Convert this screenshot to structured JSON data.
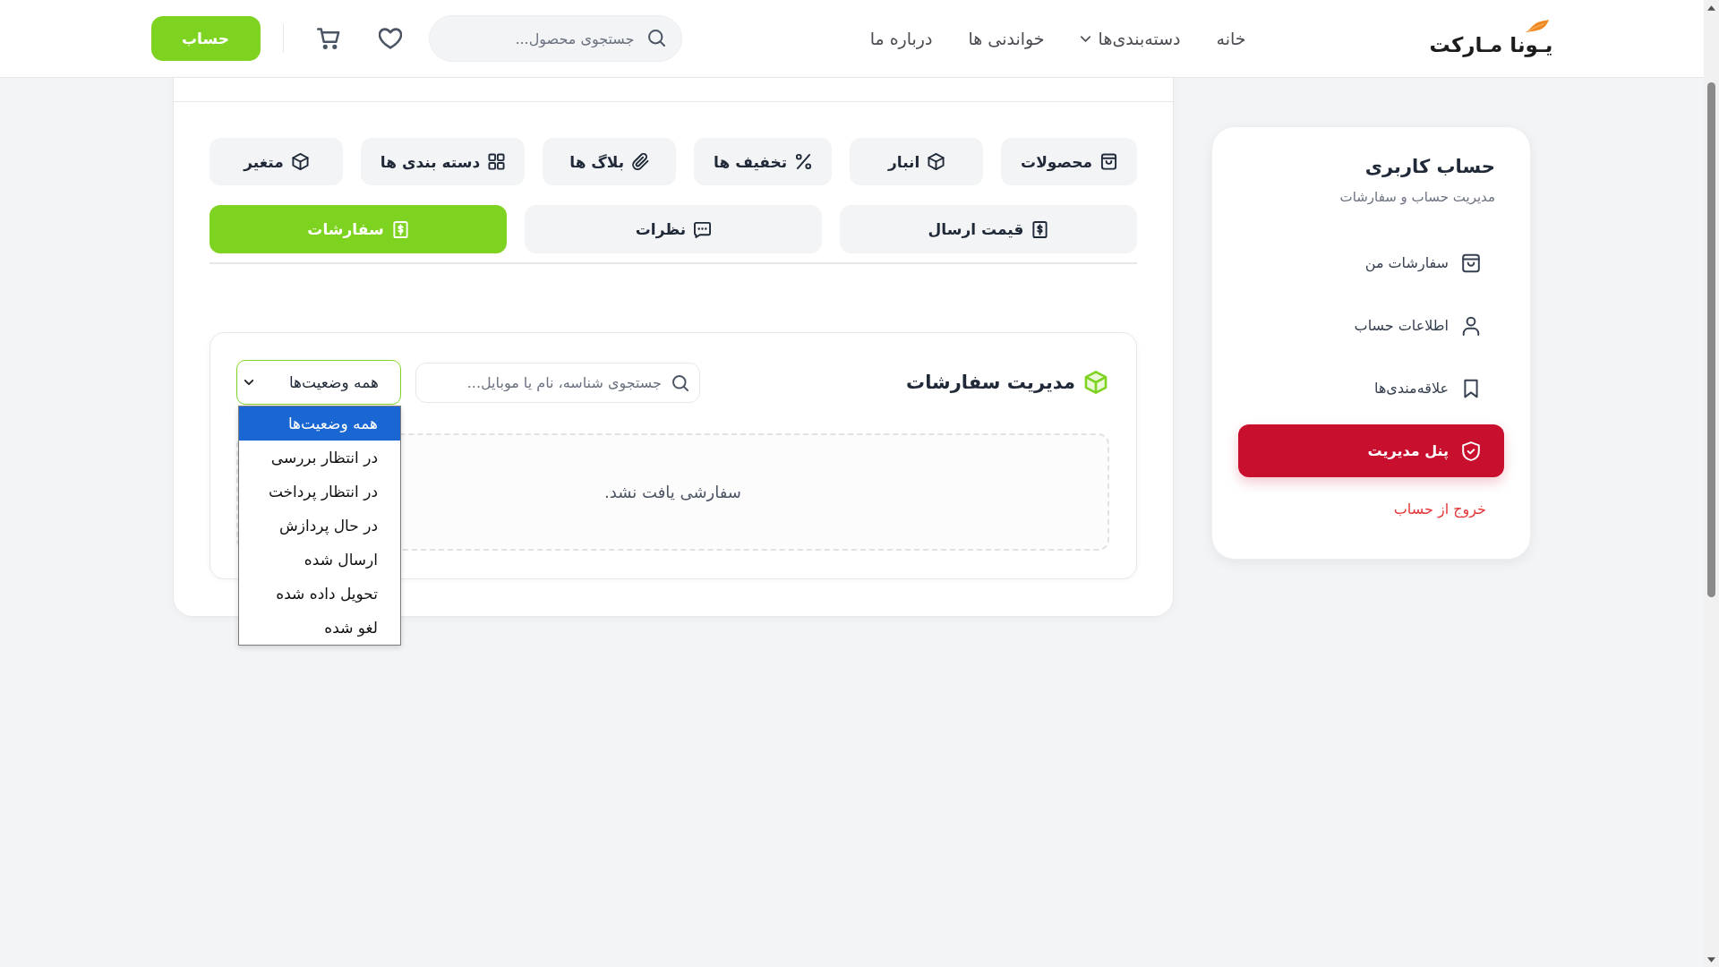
{
  "header": {
    "logo": "یـونا مـارکت",
    "nav": [
      {
        "label": "خانه",
        "has_menu": false
      },
      {
        "label": "دسته‌بندی‌ها",
        "has_menu": true
      },
      {
        "label": "خواندنی ها",
        "has_menu": false
      },
      {
        "label": "درباره ما",
        "has_menu": false
      }
    ],
    "search": {
      "placeholder": "جستجوی محصول..."
    },
    "account_button": "حساب"
  },
  "sidebar": {
    "title": "حساب کاربری",
    "subtitle": "مدیریت حساب و سفارشات",
    "items": [
      {
        "label": "سفارشات من",
        "selected": false
      },
      {
        "label": "اطلاعات حساب",
        "selected": false
      },
      {
        "label": "علاقه‌مندی‌ها",
        "selected": false
      },
      {
        "label": "پنل مدیریت",
        "selected": true
      }
    ],
    "logout": "خروج از حساب"
  },
  "main": {
    "tab_rows": [
      [
        {
          "label": "محصولات",
          "selected": false
        },
        {
          "label": "انبار",
          "selected": false
        },
        {
          "label": "تخفیف ها",
          "selected": false
        },
        {
          "label": "بلاگ ها",
          "selected": false
        },
        {
          "label": "دسته بندی ها",
          "selected": false
        },
        {
          "label": "متغیر",
          "selected": false
        }
      ],
      [
        {
          "label": "قیمت ارسال",
          "selected": false
        },
        {
          "label": "نظرات",
          "selected": false
        },
        {
          "label": "سفارشات",
          "selected": true
        }
      ]
    ],
    "orders": {
      "title": "مدیریت سفارشات",
      "search": {
        "placeholder": "جستجوی شناسه، نام یا موبایل..."
      },
      "status_filter": {
        "value": "همه وضعیت‌ها",
        "expanded": true,
        "options": [
          {
            "label": "همه وضعیت‌ها",
            "selected": true
          },
          {
            "label": "در انتظار بررسی",
            "selected": false
          },
          {
            "label": "در انتظار پرداخت",
            "selected": false
          },
          {
            "label": "در حال پردازش",
            "selected": false
          },
          {
            "label": "ارسال شده",
            "selected": false
          },
          {
            "label": "تحویل داده شده",
            "selected": false
          },
          {
            "label": "لغو شده",
            "selected": false
          }
        ]
      },
      "empty_message": "سفارشی یافت نشد."
    }
  }
}
